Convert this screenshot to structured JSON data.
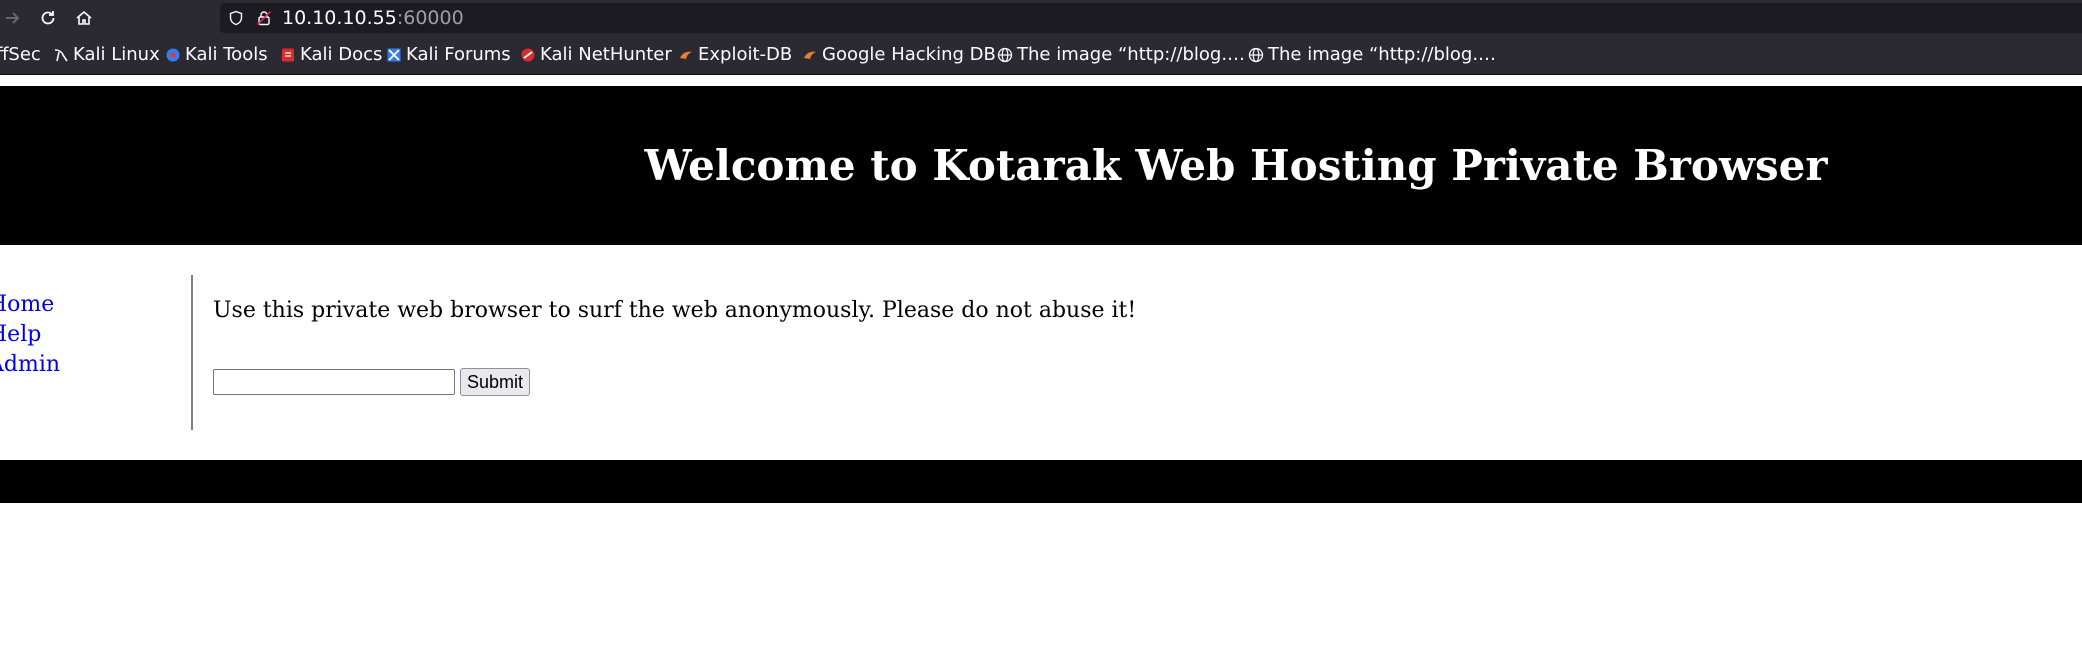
{
  "browser": {
    "url_host": "10.10.10.55",
    "url_port": ":60000",
    "bookmarks": [
      {
        "label": "ffSec",
        "icon": "offsec-icon"
      },
      {
        "label": "Kali Linux",
        "icon": "kali-dragon-icon"
      },
      {
        "label": "Kali Tools",
        "icon": "kali-tools-icon"
      },
      {
        "label": "Kali Docs",
        "icon": "kali-docs-icon"
      },
      {
        "label": "Kali Forums",
        "icon": "kali-forums-icon"
      },
      {
        "label": "Kali NetHunter",
        "icon": "nethunter-icon"
      },
      {
        "label": "Exploit-DB",
        "icon": "exploit-db-icon"
      },
      {
        "label": "Google Hacking DB",
        "icon": "ghdb-icon"
      },
      {
        "label": "The image “http://blog.…",
        "icon": "globe-icon"
      },
      {
        "label": "The image “http://blog.…",
        "icon": "globe-icon"
      }
    ]
  },
  "page": {
    "title": "Welcome to Kotarak Web Hosting Private Browser",
    "nav": [
      {
        "label": "Home"
      },
      {
        "label": "Help"
      },
      {
        "label": "Admin"
      }
    ],
    "intro": "Use this private web browser to surf the web anonymously. Please do not abuse it!",
    "input_value": "",
    "submit_label": "Submit"
  },
  "colors": {
    "chrome_bg": "#2b2a33",
    "urlbar_bg": "#1c1b22",
    "header_bg": "#000000",
    "link": "#0000ee"
  }
}
